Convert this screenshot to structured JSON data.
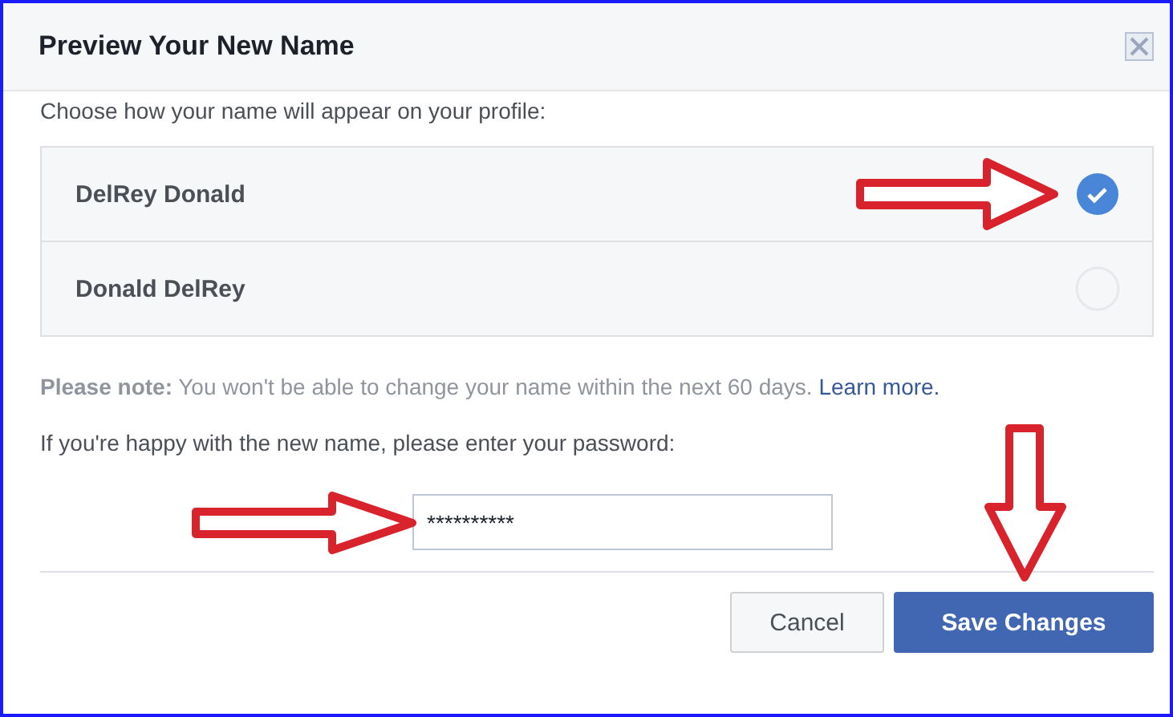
{
  "dialog": {
    "title": "Preview Your New Name",
    "subtitle": "Choose how your name will appear on your profile:"
  },
  "name_options": [
    {
      "label": "DelRey Donald",
      "selected": true
    },
    {
      "label": "Donald DelRey",
      "selected": false
    }
  ],
  "note": "**Please note:** You won't be able to change your name within the next 60 days.",
  "learn_more": "Learn more.",
  "password_prompt": "If you're happy with the new name, please enter your password:",
  "password": {
    "value": "**********"
  },
  "buttons": [
    {
      "label": "Cancel",
      "kind": "secondary"
    },
    {
      "label": "Save Changes",
      "kind": "primary"
    }
  ]
}
